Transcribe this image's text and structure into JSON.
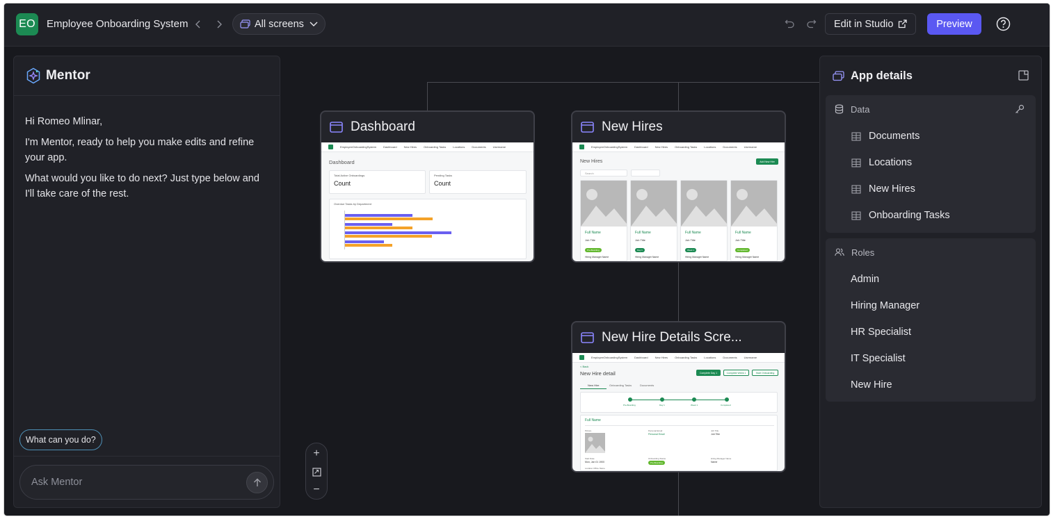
{
  "topbar": {
    "avatar_initials": "EO",
    "app_title": "Employee Onboarding System",
    "screens_label": "All screens",
    "edit_studio_label": "Edit in Studio",
    "preview_label": "Preview",
    "accent_color": "#5a58f2",
    "avatar_color": "#1c8a53"
  },
  "mentor": {
    "title": "Mentor",
    "greeting": "Hi Romeo Mlinar,",
    "intro": "I'm Mentor, ready to help you make edits and refine your app.",
    "prompt": "What would you like to do next? Just type below and I'll take care of the rest.",
    "suggestion_chip": "What can you do?",
    "input_placeholder": "Ask Mentor"
  },
  "screens": {
    "dashboard": {
      "title": "Dashboard",
      "heading": "Dashboard",
      "stat1_label": "Total Active Onboardings",
      "stat1_value": "Count",
      "stat2_label": "Pending Tasks",
      "stat2_value": "Count",
      "chart_title": "Overdue Tasks by Department"
    },
    "new_hires": {
      "title": "New Hires",
      "heading": "New Hires",
      "button": "Add New Hire",
      "search_placeholder": "Search",
      "cards": [
        {
          "name": "Full Name",
          "job": "Job Title",
          "badge": "Pre-Boarding",
          "manager": "Hiring Manager Name"
        },
        {
          "name": "Full Name",
          "job": "Job Title",
          "badge": "Day 1",
          "manager": "Hiring Manager Name"
        },
        {
          "name": "Full Name",
          "job": "Job Title",
          "badge": "Week 1",
          "manager": "Hiring Manager Name"
        },
        {
          "name": "Full Name",
          "job": "Job Title",
          "badge": "Completed",
          "manager": "Hiring Manager Name"
        }
      ]
    },
    "new_hire_details": {
      "title": "New Hire Details Scre...",
      "back": "< Back",
      "heading": "New Hire detail",
      "btn1": "Complete Day 1",
      "btn2": "Complete Week 1",
      "btn3": "Start Onboarding",
      "tabs": [
        "New Hire",
        "Onboarding Tasks",
        "Documents"
      ],
      "steps": [
        "Pre-Boarding",
        "Day 1",
        "Week 1",
        "Completed"
      ],
      "full_name": "Full Name",
      "picture_label": "Picture",
      "personal_email_label": "Personal Email",
      "personal_email_value": "Personal Email",
      "job_title_label": "Job Title",
      "job_title_value": "Job Title",
      "start_date_label": "Start Date",
      "start_date_value": "Mon, Jan 01 1900",
      "status_label": "Onboarding Status",
      "status_value": "Pre-Boarding",
      "manager_label": "Hiring Manager Name",
      "manager_value": "Name",
      "location_label": "Location Office Name"
    },
    "mini_nav": [
      "EmployeeOnboardingSystem",
      "Dashboard",
      "New Hires",
      "Onboarding Tasks",
      "Locations",
      "Documents",
      "Username"
    ]
  },
  "zoom": {
    "in": "+",
    "fit": "⤢",
    "out": "−"
  },
  "details": {
    "title": "App details",
    "data_header": "Data",
    "data_items": [
      "Documents",
      "Locations",
      "New Hires",
      "Onboarding Tasks"
    ],
    "roles_header": "Roles",
    "roles": [
      "Admin",
      "Hiring Manager",
      "HR Specialist",
      "IT Specialist",
      "New Hire"
    ]
  }
}
